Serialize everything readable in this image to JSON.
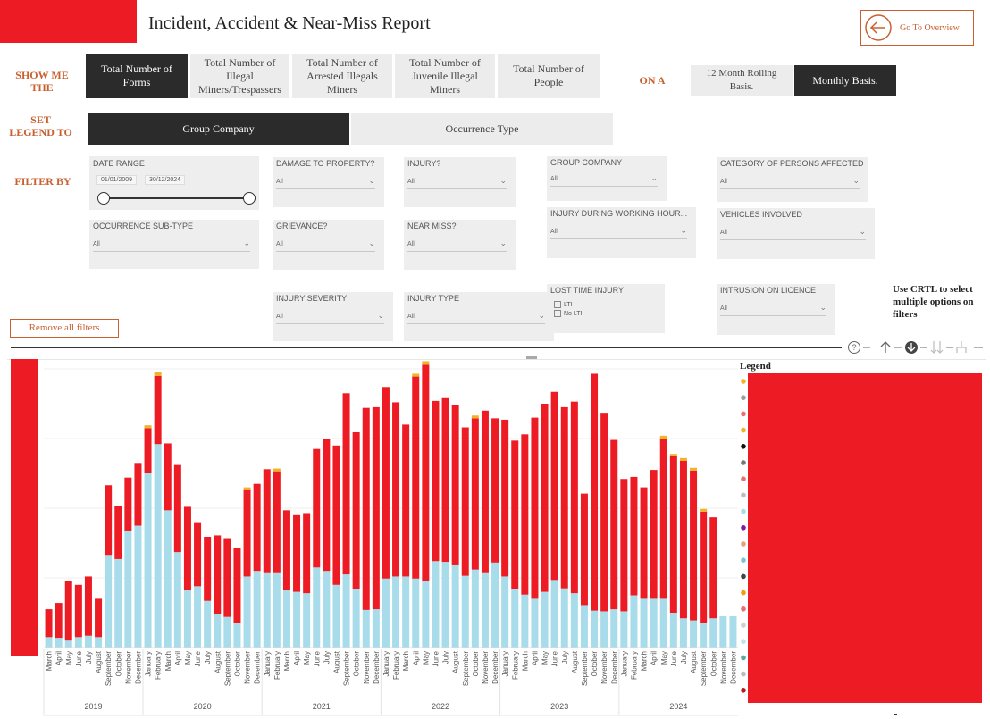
{
  "header": {
    "title": "Incident, Accident & Near-Miss Report",
    "go_overview_label": "Go To Overview"
  },
  "show_me": {
    "label": "SHOW ME THE",
    "options": [
      "Total Number of Forms",
      "Total Number of Illegal Miners/Trespassers",
      "Total Number of Arrested Illegals Miners",
      "Total Number of Juvenile Illegal Miners",
      "Total Number of People"
    ],
    "selected": 0,
    "on_a_label": "ON A",
    "basis": [
      "12 Month Rolling Basis.",
      "Monthly Basis."
    ],
    "basis_selected": 1
  },
  "legend_toggle": {
    "label": "SET LEGEND TO",
    "options": [
      "Group Company",
      "Occurrence Type"
    ],
    "selected": 0
  },
  "filters": {
    "label": "FILTER BY",
    "date_range": {
      "label": "DATE RANGE",
      "start": "01/01/2009",
      "end": "30/12/2024"
    },
    "damage_to_property": {
      "label": "DAMAGE TO PROPERTY?",
      "value": "All"
    },
    "injury": {
      "label": "INJURY?",
      "value": "All"
    },
    "group_company": {
      "label": "GROUP COMPANY",
      "value": "All"
    },
    "category_persons": {
      "label": "CATEGORY OF PERSONS AFFECTED",
      "value": "All"
    },
    "occurrence_subtype": {
      "label": "OCCURRENCE SUB-TYPE",
      "value": "All"
    },
    "grievance": {
      "label": "GRIEVANCE?",
      "value": "All"
    },
    "near_miss": {
      "label": "NEAR MISS?",
      "value": "All"
    },
    "injury_working_hours": {
      "label": "INJURY DURING WORKING HOUR...",
      "value": "All"
    },
    "vehicles_involved": {
      "label": "VEHICLES INVOLVED",
      "value": "All"
    },
    "injury_severity": {
      "label": "INJURY SEVERITY",
      "value": "All"
    },
    "injury_type": {
      "label": "INJURY TYPE",
      "value": "All"
    },
    "lost_time_injury": {
      "label": "LOST TIME INJURY",
      "options": [
        "LTI",
        "No LTI"
      ]
    },
    "intrusion_licence": {
      "label": "INTRUSION ON LICENCE",
      "value": "All"
    },
    "remove_all": "Remove all filters",
    "hint": "Use CRTL to select multiple options on filters"
  },
  "chart_legend_title": "Legend",
  "colors": {
    "accent": "#c8602f",
    "red": "#ed1c24",
    "light_blue": "#a8dcea",
    "salmon": "#f06a6a",
    "amber": "#f0b429",
    "dark": "#2b2b2b"
  },
  "legend_dot_colors": [
    "#f0b429",
    "#9e9e9e",
    "#e57373",
    "#f0b429",
    "#111111",
    "#777777",
    "#e57373",
    "#bdbdbd",
    "#a8dcea",
    "#7b1fa2",
    "#e8a07a",
    "#7fc4d6",
    "#444444",
    "#f39c12",
    "#e57373",
    "#cfcfcf",
    "#bfe3ec",
    "#5fa89a",
    "#bdbdbd",
    "#b71c1c",
    "#e8b4a0"
  ],
  "chart_data": {
    "type": "bar",
    "stacked": true,
    "ylim": [
      0,
      400
    ],
    "grid": true,
    "legend_position": "right",
    "months": [
      "March",
      "April",
      "May",
      "June",
      "July",
      "August",
      "September",
      "October",
      "November",
      "December",
      "January",
      "February",
      "March",
      "April",
      "May",
      "June",
      "July",
      "August",
      "September",
      "October",
      "November",
      "December",
      "January",
      "February",
      "March",
      "April",
      "May",
      "June",
      "July",
      "August",
      "September",
      "October",
      "November",
      "December",
      "January",
      "February",
      "March",
      "April",
      "May",
      "June",
      "July",
      "August",
      "September",
      "October",
      "November",
      "December",
      "January",
      "February",
      "March",
      "April",
      "May",
      "June",
      "July",
      "August",
      "September",
      "October",
      "November",
      "December",
      "January",
      "February",
      "March",
      "April",
      "May",
      "June",
      "July",
      "August",
      "September",
      "October",
      "November",
      "December"
    ],
    "years": [
      {
        "label": "2019",
        "count": 10
      },
      {
        "label": "2020",
        "count": 12
      },
      {
        "label": "2021",
        "count": 12
      },
      {
        "label": "2022",
        "count": 12
      },
      {
        "label": "2023",
        "count": 12
      },
      {
        "label": "2024",
        "count": 12
      }
    ],
    "series": [
      {
        "color": "#a8dcea",
        "values": [
          15,
          14,
          10,
          15,
          17,
          15,
          133,
          127,
          168,
          175,
          250,
          292,
          197,
          137,
          82,
          88,
          67,
          48,
          44,
          35,
          102,
          110,
          108,
          108,
          82,
          80,
          78,
          115,
          110,
          90,
          105,
          84,
          54,
          55,
          99,
          102,
          102,
          99,
          96,
          124,
          123,
          118,
          103,
          112,
          108,
          122,
          102,
          84,
          76,
          70,
          80,
          97,
          85,
          78,
          61,
          53,
          52,
          55,
          52,
          75,
          70,
          70,
          70,
          50,
          42,
          39,
          35,
          42,
          45,
          45,
          40,
          48
        ]
      },
      {
        "color": "#f06a6a",
        "values": [
          0,
          0,
          0,
          0,
          0,
          0,
          0,
          0,
          0,
          0,
          0,
          0,
          0,
          0,
          0,
          0,
          0,
          0,
          0,
          0,
          0,
          0,
          0,
          0,
          0,
          0,
          0,
          0,
          0,
          0,
          0,
          0,
          0,
          0,
          0,
          0,
          0,
          0,
          0,
          0,
          0,
          0,
          0,
          0,
          0,
          0,
          0,
          0,
          0,
          0,
          0,
          0,
          0,
          0,
          0,
          0,
          0,
          0,
          0,
          0,
          0,
          0,
          0,
          0,
          0,
          0,
          0,
          0,
          0,
          0,
          0,
          0
        ]
      },
      {
        "color": "#ed1c24",
        "values": [
          40,
          50,
          85,
          75,
          85,
          55,
          100,
          76,
          76,
          90,
          65,
          98,
          96,
          125,
          120,
          92,
          92,
          113,
          113,
          108,
          124,
          125,
          148,
          145,
          115,
          110,
          115,
          170,
          190,
          200,
          260,
          225,
          290,
          290,
          275,
          250,
          218,
          290,
          310,
          230,
          235,
          230,
          213,
          217,
          232,
          207,
          225,
          213,
          230,
          260,
          270,
          270,
          260,
          275,
          160,
          340,
          285,
          243,
          190,
          170,
          160,
          185,
          230,
          225,
          226,
          215,
          160,
          145
        ]
      },
      {
        "color": "#f0b429",
        "values": [
          0,
          0,
          0,
          0,
          0,
          0,
          0,
          0,
          0,
          0,
          4,
          5,
          0,
          0,
          0,
          0,
          0,
          0,
          0,
          0,
          4,
          0,
          0,
          4,
          0,
          0,
          0,
          0,
          0,
          0,
          0,
          0,
          0,
          0,
          0,
          0,
          0,
          4,
          5,
          0,
          0,
          0,
          0,
          4,
          0,
          0,
          0,
          0,
          0,
          0,
          0,
          0,
          0,
          0,
          0,
          0,
          0,
          0,
          0,
          0,
          0,
          0,
          4,
          3,
          4,
          4,
          4,
          0,
          0,
          0,
          0,
          0
        ]
      }
    ]
  }
}
